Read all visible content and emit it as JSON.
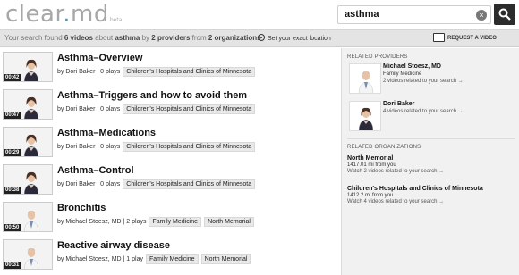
{
  "header": {
    "logo_main": "clear",
    "logo_dot": ".",
    "logo_end": "md",
    "logo_beta": "beta",
    "search_value": "asthma",
    "clear_icon": "×"
  },
  "infobar": {
    "part1": "Your search found ",
    "count": "6 videos",
    "part2": " about ",
    "query": "asthma",
    "part3": " by ",
    "providers": "2 providers",
    "part4": " from ",
    "orgs": "2 organizations",
    "location_label": "Set your exact location",
    "request_label": "REQUEST A VIDEO"
  },
  "results": [
    {
      "title": "Asthma–Overview",
      "duration": "00:42",
      "by": "by Dori Baker",
      "plays": "0 plays",
      "tags": [
        "Children's Hospitals and Clinics of Minnesota"
      ],
      "person": "woman"
    },
    {
      "title": "Asthma–Triggers and how to avoid them",
      "duration": "00:47",
      "by": "by Dori Baker",
      "plays": "0 plays",
      "tags": [
        "Children's Hospitals and Clinics of Minnesota"
      ],
      "person": "woman"
    },
    {
      "title": "Asthma–Medications",
      "duration": "00:29",
      "by": "by Dori Baker",
      "plays": "0 plays",
      "tags": [
        "Children's Hospitals and Clinics of Minnesota"
      ],
      "person": "woman"
    },
    {
      "title": "Asthma–Control",
      "duration": "00:38",
      "by": "by Dori Baker",
      "plays": "0 plays",
      "tags": [
        "Children's Hospitals and Clinics of Minnesota"
      ],
      "person": "woman"
    },
    {
      "title": "Bronchitis",
      "duration": "00:50",
      "by": "by Michael Stoesz, MD",
      "plays": "2 plays",
      "tags": [
        "Family Medicine",
        "North Memorial"
      ],
      "person": "man"
    },
    {
      "title": "Reactive airway disease",
      "duration": "00:31",
      "by": "by Michael Stoesz, MD",
      "plays": "1 play",
      "tags": [
        "Family Medicine",
        "North Memorial"
      ],
      "person": "man"
    }
  ],
  "sidebar": {
    "providers_heading": "RELATED PROVIDERS",
    "providers": [
      {
        "name": "Michael Stoesz, MD",
        "type": "Family Medicine",
        "link": "2 videos related to your search →",
        "person": "man"
      },
      {
        "name": "Dori Baker",
        "type": "",
        "link": "4 videos related to your search →",
        "person": "woman"
      }
    ],
    "orgs_heading": "RELATED ORGANIZATIONS",
    "orgs": [
      {
        "name": "North Memorial",
        "distance": "1417.01 mi from you",
        "link": "Watch 2 videos related to your search →"
      },
      {
        "name": "Children's Hospitals and Clinics of Minnesota",
        "distance": "1412.2 mi from you",
        "link": "Watch 4 videos related to your search →"
      }
    ]
  },
  "colors": {
    "accent_dot": "#3d9fd6",
    "infobar_bg": "#e4e4e4",
    "sidebar_bg": "#f1f1f1"
  }
}
